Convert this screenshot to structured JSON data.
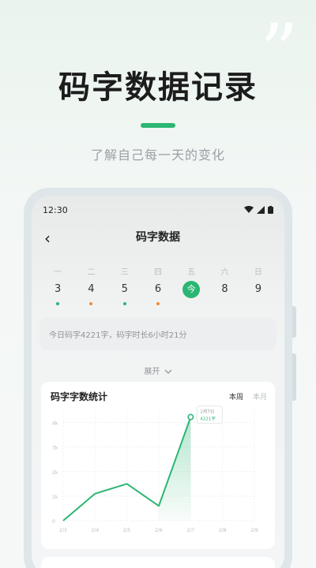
{
  "promo": {
    "title": "码字数据记录",
    "subtitle": "了解自己每一天的变化",
    "quote_glyph": "”",
    "accent_color": "#2bb673"
  },
  "status_bar": {
    "time": "12:30"
  },
  "nav": {
    "title": "码字数据",
    "back_glyph": "‹"
  },
  "week": [
    {
      "label": "一",
      "num": "3",
      "dot": "#2bb673"
    },
    {
      "label": "二",
      "num": "4",
      "dot": "#f08a3c"
    },
    {
      "label": "三",
      "num": "5",
      "dot": "#2bb673"
    },
    {
      "label": "四",
      "num": "6",
      "dot": "#f08a3c"
    },
    {
      "label": "五",
      "num": "今",
      "dot": "",
      "active": true
    },
    {
      "label": "六",
      "num": "8",
      "dot": ""
    },
    {
      "label": "日",
      "num": "9",
      "dot": ""
    }
  ],
  "summary": {
    "text": "今日码字4221字，码字时长6小时21分"
  },
  "expand": {
    "label": "展开"
  },
  "chart_card": {
    "title": "码字字数统计",
    "tabs": [
      "本周",
      "本月"
    ]
  },
  "chart_data": {
    "type": "area",
    "x": [
      "2/3",
      "2/4",
      "2/5",
      "2/6",
      "2/7",
      "2/8",
      "2/9"
    ],
    "values": [
      0,
      1100,
      1500,
      600,
      4221
    ],
    "y_ticks": [
      "0",
      "1k",
      "2k",
      "3k",
      "4k"
    ],
    "ylim": [
      0,
      4500
    ],
    "tooltip": {
      "date": "2月7日",
      "value": "4221字"
    },
    "line_color": "#2bb673",
    "grid": true
  }
}
